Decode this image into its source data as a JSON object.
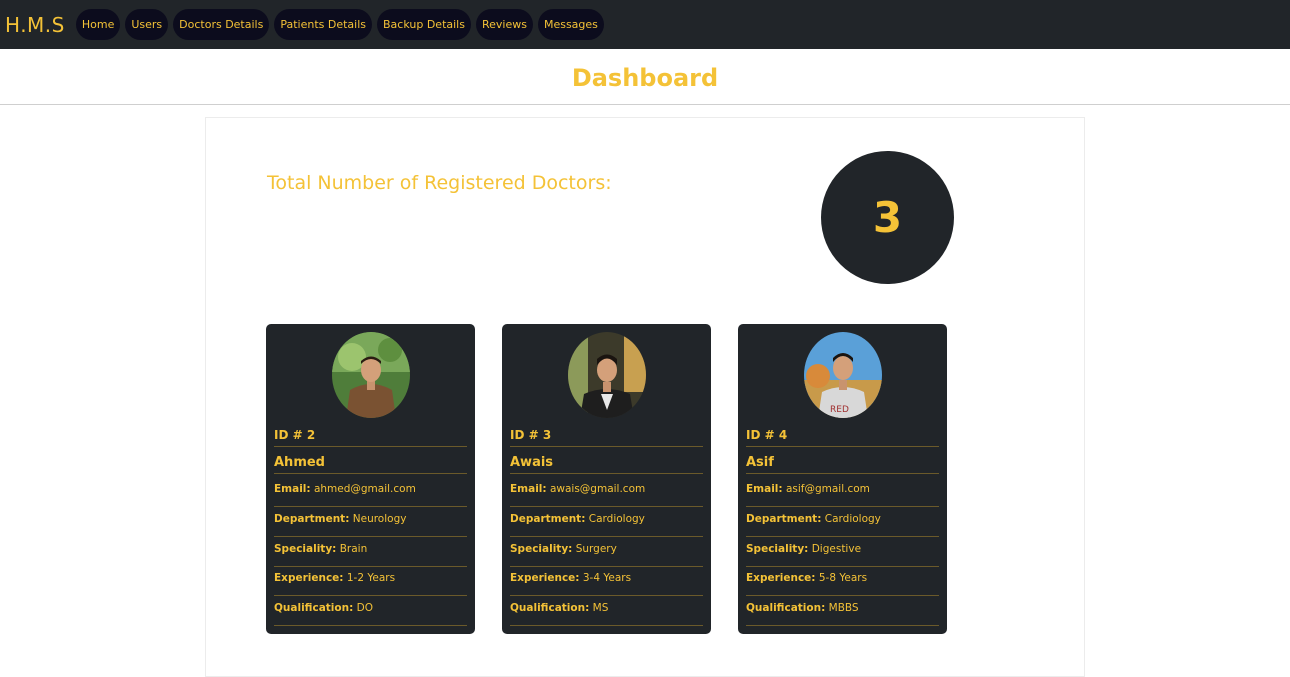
{
  "navbar": {
    "brand": "H.M.S",
    "links": [
      "Home",
      "Users",
      "Doctors Details",
      "Patients Details",
      "Backup Details",
      "Reviews",
      "Messages"
    ]
  },
  "page_title": "Dashboard",
  "summary": {
    "label": "Total Number of Registered Doctors:",
    "count": "3"
  },
  "field_labels": {
    "email": "Email:",
    "department": "Department:",
    "speciality": "Speciality:",
    "experience": "Experience:",
    "qualification": "Qualification:"
  },
  "doctors": [
    {
      "id": "ID # 2",
      "name": "Ahmed",
      "email": "ahmed@gmail.com",
      "department": "Neurology",
      "speciality": "Brain",
      "experience": "1-2 Years",
      "qualification": "DO"
    },
    {
      "id": "ID # 3",
      "name": "Awais",
      "email": "awais@gmail.com",
      "department": "Cardiology",
      "speciality": "Surgery",
      "experience": "3-4 Years",
      "qualification": "MS"
    },
    {
      "id": "ID # 4",
      "name": "Asif",
      "email": "asif@gmail.com",
      "department": "Cardiology",
      "speciality": "Digestive",
      "experience": "5-8 Years",
      "qualification": "MBBS"
    }
  ],
  "colors": {
    "accent": "#f4c237",
    "dark": "#212529"
  }
}
